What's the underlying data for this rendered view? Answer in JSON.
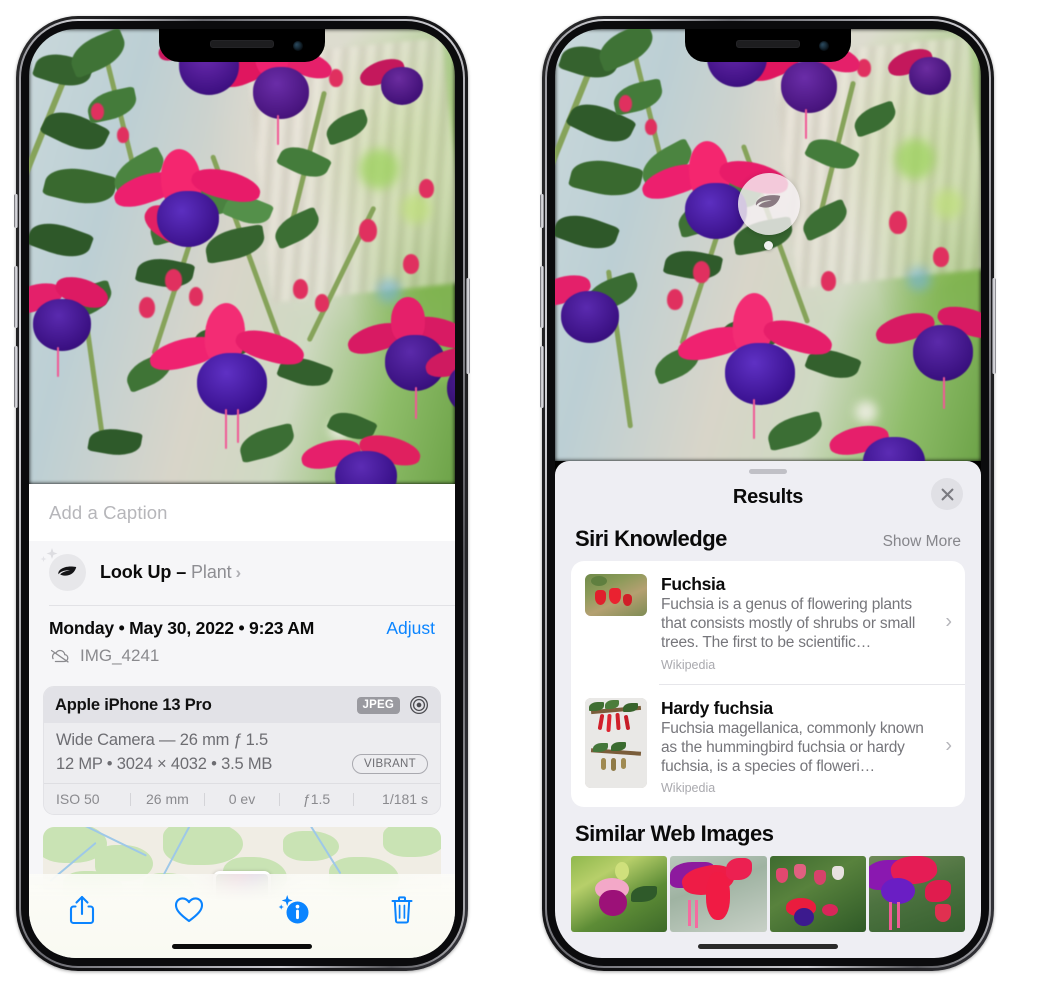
{
  "left_phone": {
    "name": "photos-detail-screen",
    "caption_field": {
      "placeholder": "Add a Caption",
      "value": ""
    },
    "lookup_row": {
      "icon": "leaf-icon",
      "label": "Look Up – ",
      "subject": "Plant",
      "chevron": "›"
    },
    "datetime": {
      "weekday": "Monday",
      "date": "May 30, 2022",
      "time": "9:23 AM",
      "full": "Monday • May 30, 2022 • 9:23 AM",
      "adjust_label": "Adjust"
    },
    "filename": {
      "icon": "icloud-slash-icon",
      "value": "IMG_4241"
    },
    "exif": {
      "device": "Apple iPhone 13 Pro",
      "format_badge": "JPEG",
      "raw_icon": "aperture-icon",
      "lens": "Wide Camera — 26 mm ƒ 1.5",
      "size_line": "12 MP • 3024 × 4032 • 3.5 MB",
      "style_badge": "VIBRANT",
      "stats": [
        "ISO 50",
        "26 mm",
        "0 ev",
        "ƒ1.5",
        "1/181 s"
      ]
    },
    "map": {
      "name": "location-map-preview",
      "pin": "photo-thumbnail-pin"
    },
    "toolbar": [
      {
        "name": "share-button",
        "icon": "share-icon"
      },
      {
        "name": "favorite-button",
        "icon": "heart-icon"
      },
      {
        "name": "visual-lookup-info-button",
        "icon": "info-sparkle-icon"
      },
      {
        "name": "delete-button",
        "icon": "trash-icon"
      }
    ],
    "accent_color": "#0a84ff"
  },
  "right_phone": {
    "name": "visual-lookup-results-screen",
    "photo_badge": {
      "icon": "leaf-icon",
      "name": "visual-lookup-badge"
    },
    "sheet": {
      "title": "Results",
      "close_icon": "close-icon",
      "sections": [
        {
          "title": "Siri Knowledge",
          "action_label": "Show More",
          "items": [
            {
              "title": "Fuchsia",
              "description": "Fuchsia is a genus of flowering plants that consists mostly of shrubs or small trees. The first to be scientific…",
              "source": "Wikipedia",
              "thumb": "fuchsia-red-flowers-thumbnail"
            },
            {
              "title": "Hardy fuchsia",
              "description": "Fuchsia magellanica, commonly known as the hummingbird fuchsia or hardy fuchsia, is a species of floweri…",
              "source": "Wikipedia",
              "thumb": "hardy-fuchsia-specimen-thumbnail"
            }
          ]
        },
        {
          "title": "Similar Web Images",
          "images": [
            "fuchsia-pink-white-thumbnail",
            "fuchsia-red-closeup-thumbnail",
            "fuchsia-bush-thumbnail",
            "fuchsia-purple-pink-thumbnail"
          ]
        }
      ]
    }
  },
  "colors": {
    "accent_blue": "#0a84ff",
    "sheet_bg": "#eeeef3",
    "card_bg": "#ffffff",
    "secondary_text": "#8e8e93",
    "flower_pink": "#e8246e",
    "flower_purple": "#4b1f9e"
  }
}
